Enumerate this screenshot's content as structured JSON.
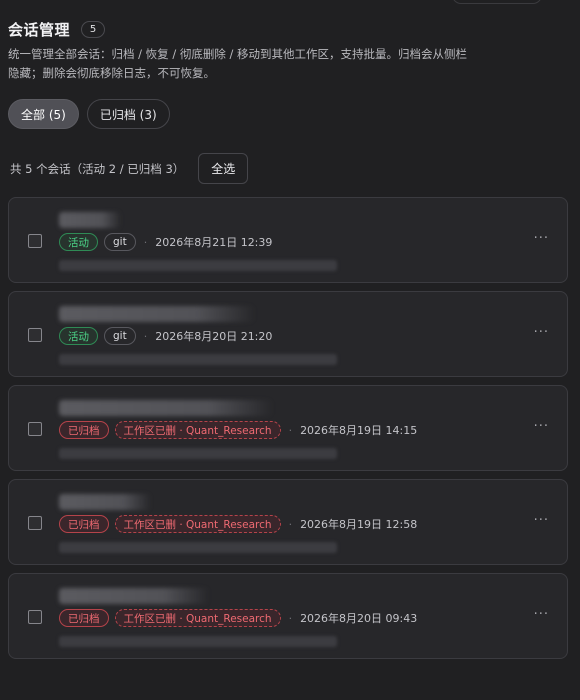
{
  "page": {
    "title": "会话管理",
    "count": "5",
    "description_line1": "统一管理全部会话：归档 / 恢复 / 彻底删除 / 移动到其他工作区，支持批量。归档会从侧栏",
    "description_line2": "隐藏；删除会彻底移除日志，不可恢复。"
  },
  "filters": [
    {
      "label": "全部 (5)",
      "active": true
    },
    {
      "label": "已归档 (3)",
      "active": false
    }
  ],
  "summary": {
    "text": "共 5 个会话（活动 2 / 已归档 3）",
    "select_all_label": "全选"
  },
  "sessions": [
    {
      "tags": [
        "活动",
        "git"
      ],
      "time": "2026年8月21日 12:39",
      "more": "···"
    },
    {
      "tags": [
        "活动",
        "git"
      ],
      "time": "2026年8月20日 21:20",
      "more": "···"
    },
    {
      "tags": [
        "已归档",
        "工作区已删 · Quant_Research"
      ],
      "time": "2026年8月19日 14:15",
      "more": "···"
    },
    {
      "tags": [
        "已归档",
        "工作区已删 · Quant_Research"
      ],
      "time": "2026年8月19日 12:58",
      "more": "···"
    },
    {
      "tags": [
        "已归档",
        "工作区已删 · Quant_Research"
      ],
      "time": "2026年8月20日 09:43",
      "more": "···"
    }
  ],
  "separator": "·",
  "colors": {
    "background": "#202022",
    "active_green": "#4cd488",
    "archived_red": "#ef6a72"
  }
}
